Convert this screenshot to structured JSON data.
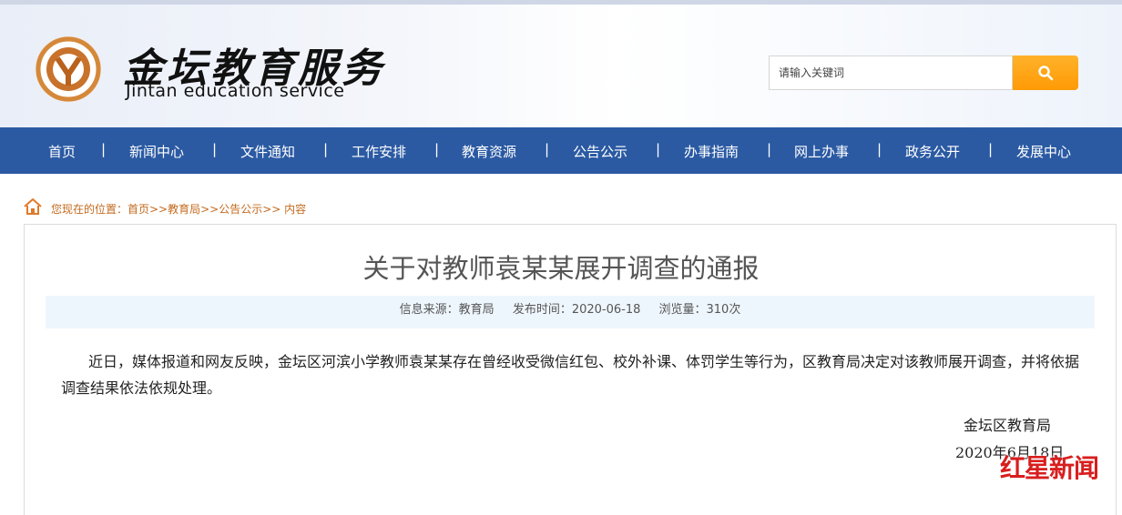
{
  "site": {
    "logo_cn": "金坛教育服务",
    "logo_en": "Jintan education service"
  },
  "search": {
    "placeholder": "请输入关键词",
    "icon": "search-icon"
  },
  "nav": {
    "items": [
      "首页",
      "新闻中心",
      "文件通知",
      "工作安排",
      "教育资源",
      "公告公示",
      "办事指南",
      "网上办事",
      "政务公开",
      "发展中心"
    ],
    "separator": "|"
  },
  "breadcrumb": {
    "icon": "home-icon",
    "text": "您现在的位置：首页>>教育局>>公告公示>> 内容"
  },
  "article": {
    "title": "关于对教师袁某某展开调查的通报",
    "source": "信息来源：教育局",
    "published": "发布时间：2020-06-18",
    "views": "浏览量：310次",
    "body": "近日，媒体报道和网友反映，金坛区河滨小学教师袁某某存在曾经收受微信红包、校外补课、体罚学生等行为，区教育局决定对该教师展开调查，并将依据调查结果依法依规处理。",
    "signature_org": "金坛区教育局",
    "signature_date": "2020年6月18日"
  },
  "watermark": {
    "text": "红星新闻",
    "color": "#d81e1e"
  },
  "colors": {
    "nav_bg": "#2b5aa3",
    "search_button": "#ff9a05",
    "breadcrumb_text": "#c46a1e",
    "meta_bar_bg": "#eef6fd"
  }
}
